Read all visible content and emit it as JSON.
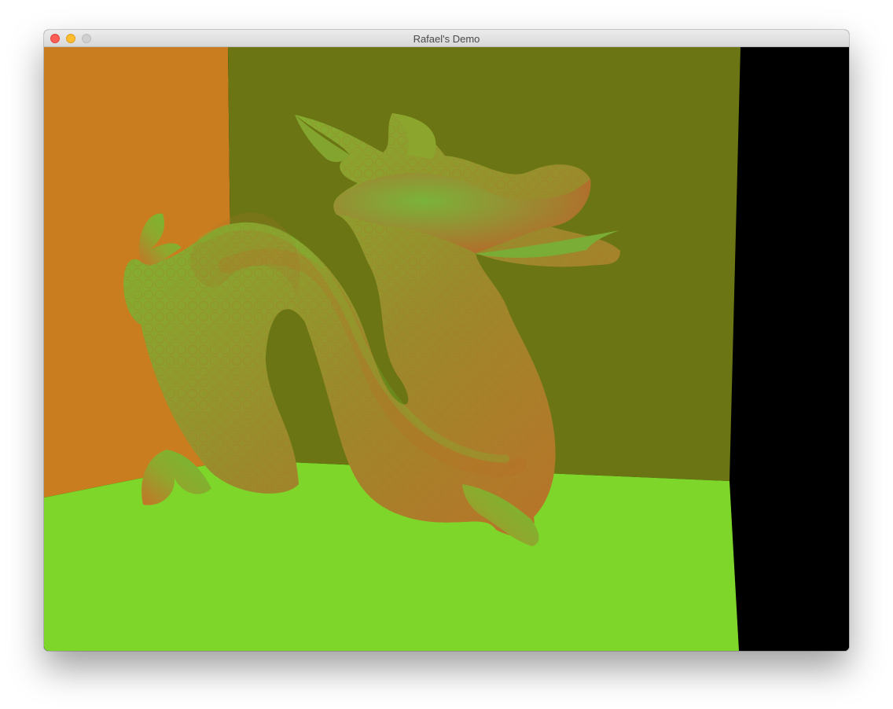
{
  "window": {
    "title": "Rafael's Demo",
    "controls": {
      "close_color": "#ff5f57",
      "minimize_color": "#febc2e",
      "zoom_color": "#cfcfcf"
    }
  },
  "scene": {
    "left_wall_color": "#c97d1e",
    "back_wall_color": "#6b7514",
    "floor_color": "#7ed62b",
    "background_color": "#000000",
    "model_color": "#6cad2c",
    "model_shade_color": "#b46a2b"
  }
}
